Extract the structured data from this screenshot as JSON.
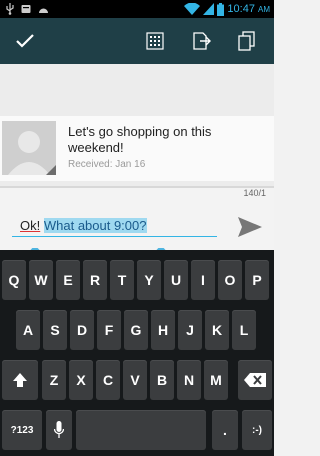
{
  "status_bar": {
    "icons": [
      "usb-icon",
      "notification-icon",
      "android-icon",
      "wifi-icon",
      "signal-icon",
      "battery-icon"
    ],
    "time": "10:47",
    "ampm": "AM"
  },
  "action_bar": {
    "background": "#1f3f47",
    "icons": [
      "done-check-icon",
      "dialpad-icon",
      "attach-icon",
      "copy-icon"
    ]
  },
  "message": {
    "text": "Let's go shopping on this weekend!",
    "received": "Received: Jan 16"
  },
  "compose": {
    "counter": "140/1",
    "ok": "Ok!",
    "space": " ",
    "selected_text": "What about 9:00?",
    "accent": "#33b5e5"
  },
  "keyboard": {
    "row1": [
      "Q",
      "W",
      "E",
      "R",
      "T",
      "Y",
      "U",
      "I",
      "O",
      "P"
    ],
    "row2": [
      "A",
      "S",
      "D",
      "F",
      "G",
      "H",
      "J",
      "K",
      "L"
    ],
    "row3": [
      "Z",
      "X",
      "C",
      "V",
      "B",
      "N",
      "M"
    ],
    "symbols_label": "?123",
    "period_label": ".",
    "smiley_label": ":-)",
    "shift_icon": "shift-arrow-icon",
    "delete_icon": "backspace-icon",
    "mic_icon": "microphone-icon"
  }
}
